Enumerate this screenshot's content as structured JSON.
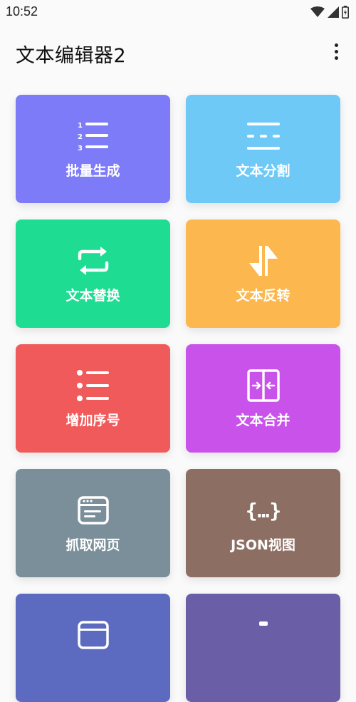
{
  "status_bar": {
    "time": "10:52",
    "icons": [
      "wifi-icon",
      "signal-icon",
      "battery-icon"
    ]
  },
  "app_bar": {
    "title": "文本编辑器2",
    "menu_icon": "more-vert-icon"
  },
  "cards": [
    {
      "label": "批量生成",
      "icon": "numbered-list-icon",
      "color": "#7d7bf7"
    },
    {
      "label": "文本分割",
      "icon": "split-lines-icon",
      "color": "#6ec9f7"
    },
    {
      "label": "文本替换",
      "icon": "swap-arrows-icon",
      "color": "#1fdc93"
    },
    {
      "label": "文本反转",
      "icon": "reverse-arrows-icon",
      "color": "#fcb84f"
    },
    {
      "label": "增加序号",
      "icon": "bullet-list-icon",
      "color": "#f05a5a"
    },
    {
      "label": "文本合并",
      "icon": "merge-icon",
      "color": "#c953ea"
    },
    {
      "label": "抓取网页",
      "icon": "browser-window-icon",
      "color": "#7b8f9a"
    },
    {
      "label": "JSON视图",
      "icon": "json-braces-icon",
      "color": "#8d6e63"
    },
    {
      "label": "",
      "icon": "window-icon",
      "color": "#5c6bc0"
    },
    {
      "label": "",
      "icon": "unknown-icon",
      "color": "#6a5fa6"
    }
  ]
}
